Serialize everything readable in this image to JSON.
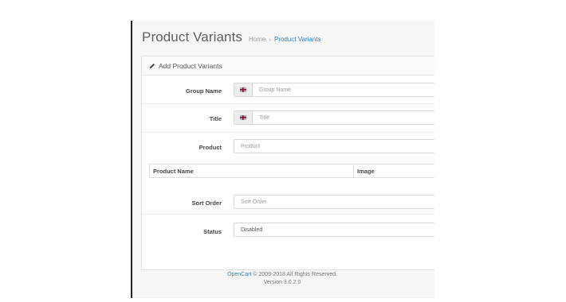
{
  "header": {
    "title": "Product Variants",
    "breadcrumb": [
      {
        "label": "Home"
      },
      {
        "label": "Product Variants"
      }
    ],
    "separator": "›"
  },
  "panel": {
    "heading": "Add Product Variants",
    "heading_icon": "pencil-icon"
  },
  "form": {
    "group_name": {
      "label": "Group Name",
      "placeholder": "Group Name",
      "addon_icon": "flag-uk-icon"
    },
    "title": {
      "label": "Title",
      "placeholder": "Title",
      "addon_icon": "flag-uk-icon"
    },
    "product": {
      "label": "Product",
      "placeholder": "Product"
    },
    "sort_order": {
      "label": "Sort Order",
      "placeholder": "Sort Order"
    },
    "status": {
      "label": "Status",
      "value": "Disabled"
    }
  },
  "table": {
    "columns": [
      "Product Name",
      "Image"
    ]
  },
  "footer": {
    "link": "OpenCart",
    "copyright": "© 2009-2018 All Rights Reserved.",
    "version": "Version 3.0.2.0"
  },
  "colors": {
    "link": "#2a84c5",
    "sidebar_border": "#1d2530"
  }
}
